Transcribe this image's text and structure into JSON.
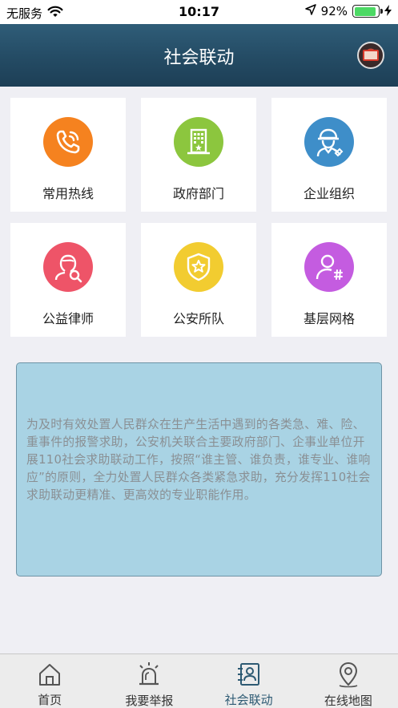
{
  "status_bar": {
    "carrier": "无服务",
    "time": "10:17",
    "battery_percent": "92%",
    "battery_level": 0.92,
    "icons": [
      "wifi-icon",
      "location-arrow-icon",
      "battery-icon",
      "charging-icon"
    ]
  },
  "header": {
    "title": "社会联动"
  },
  "tiles": [
    {
      "label": "常用热线",
      "icon": "phone-icon",
      "color": "#f5821f"
    },
    {
      "label": "政府部门",
      "icon": "building-icon",
      "color": "#8cc63e"
    },
    {
      "label": "企业组织",
      "icon": "worker-icon",
      "color": "#3e8ec9"
    },
    {
      "label": "公益律师",
      "icon": "lawyer-icon",
      "color": "#ee5468"
    },
    {
      "label": "公安所队",
      "icon": "police-badge-icon",
      "color": "#f2cc30"
    },
    {
      "label": "基层网格",
      "icon": "grid-person-icon",
      "color": "#c45ce0"
    }
  ],
  "notice": {
    "text": "为及时有效处置人民群众在生产生活中遇到的各类急、难、险、重事件的报警求助，公安机关联合主要政府部门、企事业单位开展110社会求助联动工作，按照“谁主管、谁负责，谁专业、谁响应”的原则，全力处置人民群众各类紧急求助，充分发挥110社会求助联动更精准、更高效的专业职能作用。"
  },
  "tabbar": {
    "active_index": 2,
    "active_color": "#2d5a73",
    "tabs": [
      {
        "label": "首页",
        "icon": "home-icon"
      },
      {
        "label": "我要举报",
        "icon": "alarm-light-icon"
      },
      {
        "label": "社会联动",
        "icon": "contacts-icon"
      },
      {
        "label": "在线地图",
        "icon": "map-pin-icon"
      }
    ]
  }
}
